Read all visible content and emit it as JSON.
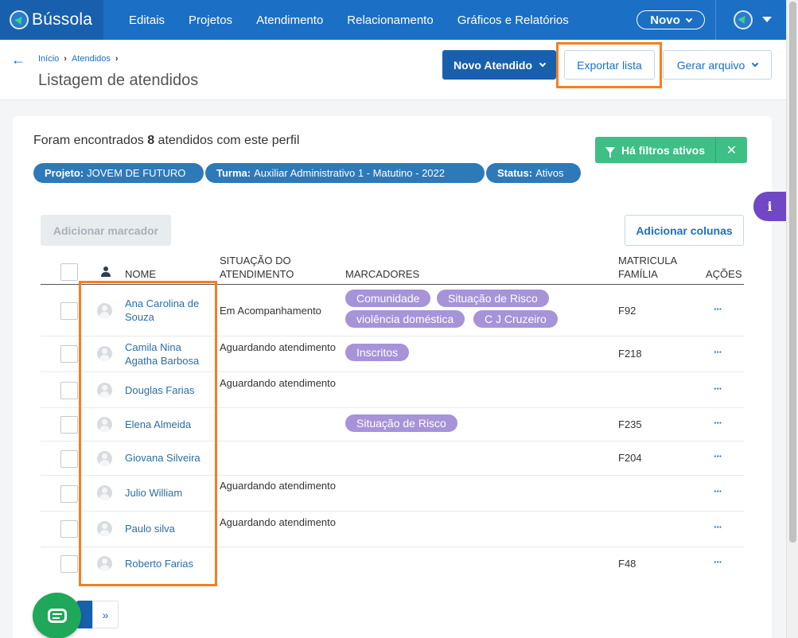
{
  "app": {
    "logo_text": "Bússola"
  },
  "nav": {
    "items": [
      "Editais",
      "Projetos",
      "Atendimento",
      "Relacionamento",
      "Gráficos e Relatórios"
    ],
    "novo_label": "Novo"
  },
  "breadcrumb": {
    "home": "Início",
    "current": "Atendidos",
    "sep": "›"
  },
  "page": {
    "title": "Listagem de atendidos",
    "back_arrow": "←"
  },
  "actions": {
    "novo_atendido": "Novo Atendido",
    "exportar": "Exportar lista",
    "gerar": "Gerar arquivo"
  },
  "summary": {
    "prefix": "Foram encontrados ",
    "count": "8",
    "suffix": " atendidos com este perfil"
  },
  "filters": {
    "chips": [
      {
        "key": "Projeto:",
        "value": "JOVEM DE FUTURO"
      },
      {
        "key": "Turma:",
        "value": "Auxiliar Administrativo 1 - Matutino - 2022"
      },
      {
        "key": "Status:",
        "value": "Ativos"
      }
    ],
    "active_label": "Há filtros ativos",
    "clear": "✕"
  },
  "info_tab": "i",
  "toolbar": {
    "add_marcador": "Adicionar marcador",
    "add_colunas": "Adicionar colunas"
  },
  "table": {
    "headers": {
      "nome": "NOME",
      "situacao_1": "SITUAÇÃO DO",
      "situacao_2": "ATENDIMENTO",
      "marcadores": "MARCADORES",
      "matricula_1": "MATRICULA",
      "matricula_2": "FAMÍLIA",
      "acoes": "AÇÕES"
    },
    "rows": [
      {
        "name": "Ana Carolina de Souza",
        "situacao": "Em Acompanhamento",
        "tags": [
          "Comunidade",
          "Situação de Risco",
          "violência doméstica",
          "C J Cruzeiro"
        ],
        "matricula": "F92",
        "actions": "···"
      },
      {
        "name": "Camila Nina Agatha Barbosa",
        "situacao": "Aguardando atendimento",
        "tags": [
          "Inscritos"
        ],
        "matricula": "F218",
        "actions": "···"
      },
      {
        "name": "Douglas Farias",
        "situacao": "Aguardando atendimento",
        "tags": [],
        "matricula": "",
        "actions": "···"
      },
      {
        "name": "Elena Almeida",
        "situacao": "",
        "tags": [
          "Situação de Risco"
        ],
        "matricula": "F235",
        "actions": "···"
      },
      {
        "name": "Giovana Silveira",
        "situacao": "",
        "tags": [],
        "matricula": "F204",
        "actions": "···"
      },
      {
        "name": "Julio William",
        "situacao": "Aguardando atendimento",
        "tags": [],
        "matricula": "",
        "actions": "···"
      },
      {
        "name": "Paulo silva",
        "situacao": "Aguardando atendimento",
        "tags": [],
        "matricula": "",
        "actions": "···"
      },
      {
        "name": "Roberto Farias",
        "situacao": "",
        "tags": [],
        "matricula": "F48",
        "actions": "···"
      }
    ]
  },
  "pagination": {
    "next": "»"
  },
  "colors": {
    "nav": "#1b6fc4",
    "primary": "#1860ad",
    "chip": "#2e79b8",
    "tag": "#a693d8",
    "filter_active": "#3dbf85",
    "info": "#7048c6",
    "highlight": "#f47f20",
    "chat": "#1fa85a"
  }
}
